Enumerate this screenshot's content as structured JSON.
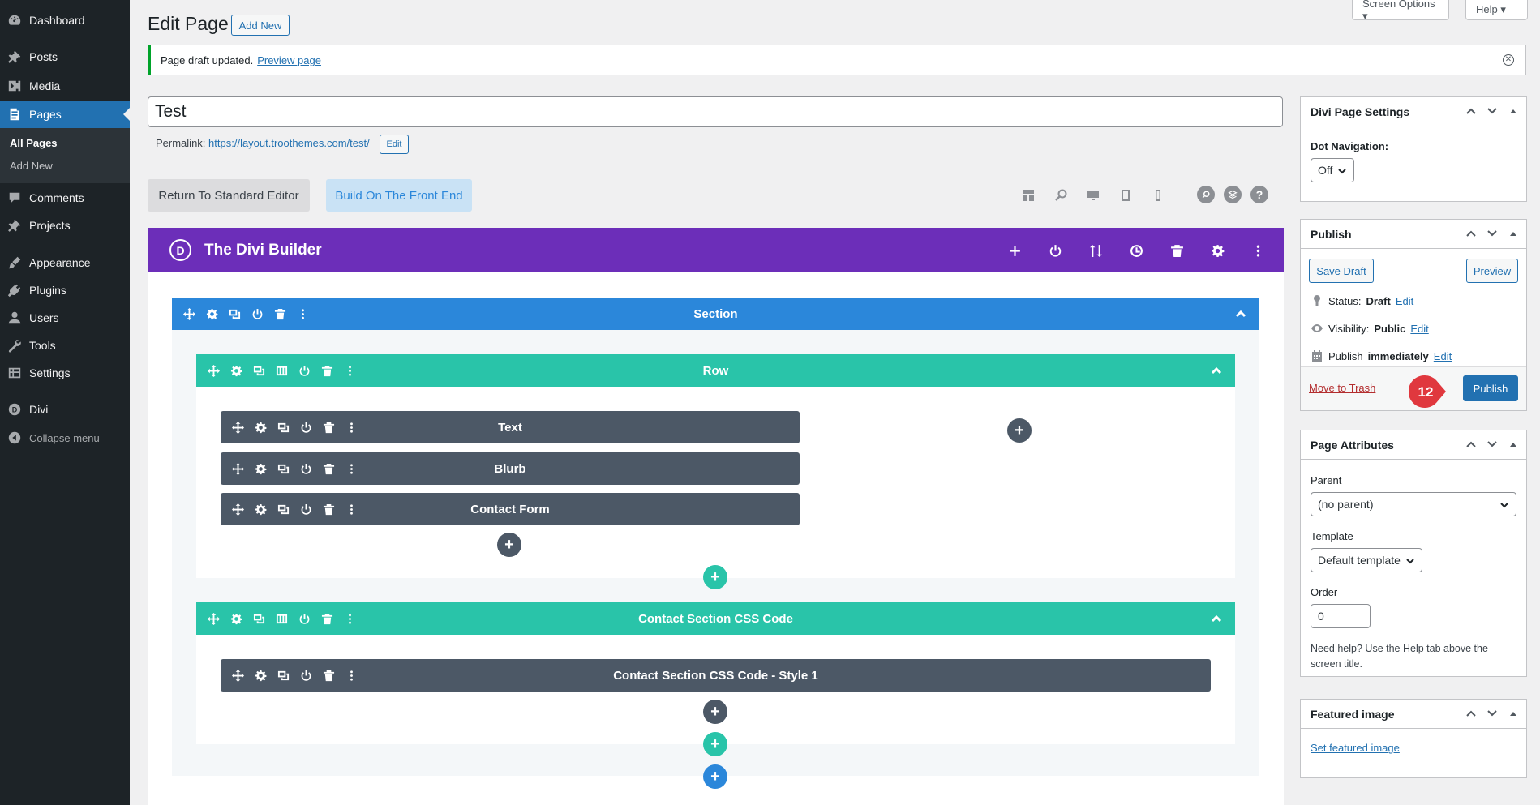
{
  "sidebar": {
    "items": [
      {
        "label": "Dashboard",
        "icon": "dashboard-icon"
      },
      {
        "label": "Posts",
        "icon": "pin-icon"
      },
      {
        "label": "Media",
        "icon": "media-icon"
      },
      {
        "label": "Pages",
        "icon": "pages-icon"
      },
      {
        "label": "Comments",
        "icon": "comment-icon"
      },
      {
        "label": "Projects",
        "icon": "pin-icon"
      },
      {
        "label": "Appearance",
        "icon": "brush-icon"
      },
      {
        "label": "Plugins",
        "icon": "plug-icon"
      },
      {
        "label": "Users",
        "icon": "user-icon"
      },
      {
        "label": "Tools",
        "icon": "wrench-icon"
      },
      {
        "label": "Settings",
        "icon": "settings-icon"
      },
      {
        "label": "Divi",
        "icon": "divi-icon"
      },
      {
        "label": "Collapse menu",
        "icon": "collapse-icon"
      }
    ],
    "submenu": [
      "All Pages",
      "Add New"
    ]
  },
  "top": {
    "screen_options": "Screen Options ▾",
    "help": "Help ▾"
  },
  "heading": {
    "title": "Edit Page",
    "add_new": "Add New"
  },
  "notice": {
    "text": "Page draft updated.",
    "link": "Preview page"
  },
  "post": {
    "title": "Test",
    "permalink_label": "Permalink:",
    "permalink_url": "https://layout.troothemes.com/test/",
    "edit": "Edit"
  },
  "builder_buttons": {
    "standard": "Return To Standard Editor",
    "front": "Build On The Front End"
  },
  "divi": {
    "logo": "D",
    "title": "The Divi Builder",
    "section": "Section",
    "row1": "Row",
    "modules1": [
      "Text",
      "Blurb",
      "Contact Form"
    ],
    "row2": "Contact Section CSS Code",
    "modules2": [
      "Contact Section CSS Code - Style 1"
    ],
    "add": "+"
  },
  "divi_settings": {
    "title": "Divi Page Settings",
    "dot_nav_label": "Dot Navigation:",
    "dot_nav_value": "Off"
  },
  "publish": {
    "title": "Publish",
    "save_draft": "Save Draft",
    "preview": "Preview",
    "status_label": "Status:",
    "status_value": "Draft",
    "visibility_label": "Visibility:",
    "visibility_value": "Public",
    "publish_label": "Publish",
    "publish_value": "immediately",
    "edit": "Edit",
    "move_to_trash": "Move to Trash",
    "publish_button": "Publish",
    "step_number": "12"
  },
  "page_attributes": {
    "title": "Page Attributes",
    "parent_label": "Parent",
    "parent_value": "(no parent)",
    "template_label": "Template",
    "template_value": "Default template",
    "order_label": "Order",
    "order_value": "0",
    "help_text": "Need help? Use the Help tab above the screen title."
  },
  "featured_image": {
    "title": "Featured image",
    "set_link": "Set featured image"
  },
  "colors": {
    "admin_bg": "#1d2327",
    "accent": "#2271b1",
    "divi_purple": "#6c2eb9",
    "section_blue": "#2b87da",
    "row_teal": "#29c4a9",
    "module_gray": "#4c5866",
    "badge_red": "#e0383e"
  }
}
